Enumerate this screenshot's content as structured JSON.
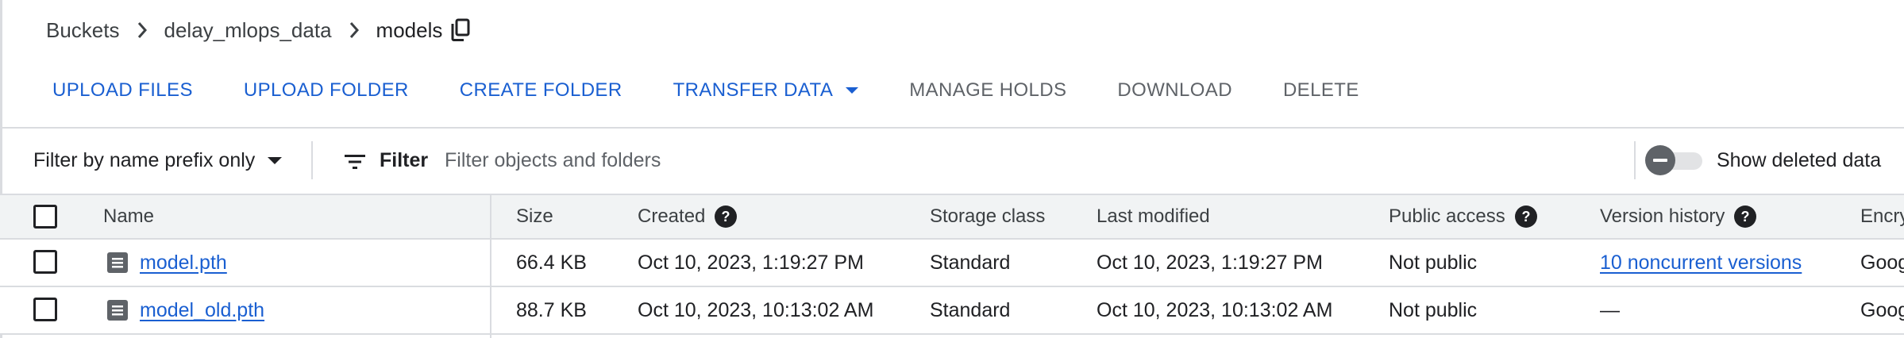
{
  "breadcrumb": {
    "items": [
      "Buckets",
      "delay_mlops_data"
    ],
    "current": "models"
  },
  "toolbar": {
    "upload_files": "UPLOAD FILES",
    "upload_folder": "UPLOAD FOLDER",
    "create_folder": "CREATE FOLDER",
    "transfer_data": "TRANSFER DATA",
    "manage_holds": "MANAGE HOLDS",
    "download": "DOWNLOAD",
    "delete": "DELETE"
  },
  "filter": {
    "prefix_mode": "Filter by name prefix only",
    "label": "Filter",
    "placeholder": "Filter objects and folders",
    "show_deleted_label": "Show deleted data",
    "show_deleted_on": false
  },
  "table": {
    "headers": {
      "name": "Name",
      "size": "Size",
      "created": "Created",
      "storage_class": "Storage class",
      "last_modified": "Last modified",
      "public_access": "Public access",
      "version_history": "Version history",
      "encryption": "Encry"
    },
    "rows": [
      {
        "name": "model.pth",
        "size": "66.4 KB",
        "created": "Oct 10, 2023, 1:19:27 PM",
        "storage_class": "Standard",
        "last_modified": "Oct 10, 2023, 1:19:27 PM",
        "public_access": "Not public",
        "version_history": "10 noncurrent versions",
        "encryption": "Goog"
      },
      {
        "name": "model_old.pth",
        "size": "88.7 KB",
        "created": "Oct 10, 2023, 10:13:02 AM",
        "storage_class": "Standard",
        "last_modified": "Oct 10, 2023, 10:13:02 AM",
        "public_access": "Not public",
        "version_history": "—",
        "encryption": "Goog"
      }
    ]
  },
  "colors": {
    "accent": "#1a5fd1",
    "muted": "#5f6368",
    "border": "#dadce0",
    "header_bg": "#f1f3f4"
  },
  "icons": {
    "breadcrumb_separator": "chevron-right-icon",
    "copy": "copy-icon",
    "dropdown": "arrow-drop-down-icon",
    "filter": "filter-list-icon",
    "help": "help-icon",
    "file": "file-icon"
  }
}
